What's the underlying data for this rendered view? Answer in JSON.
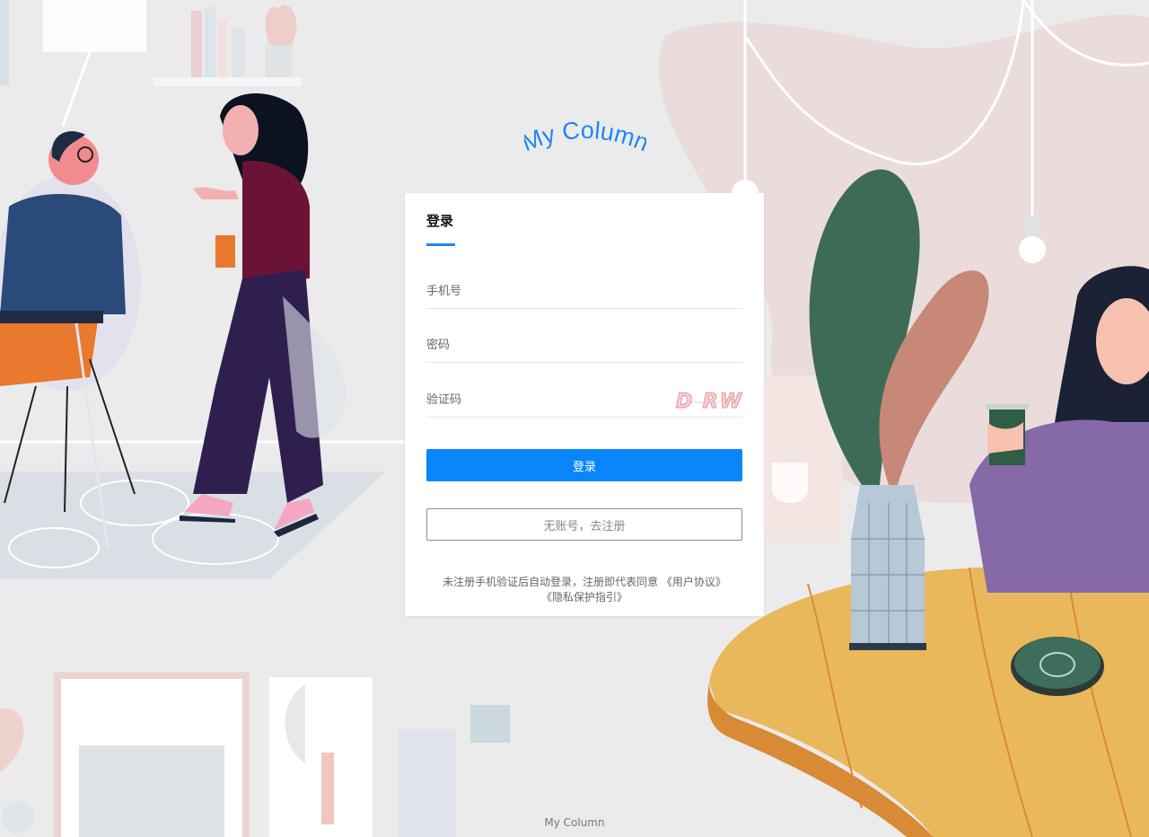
{
  "logo": {
    "text": "My Column"
  },
  "login": {
    "tab_label": "登录",
    "phone": {
      "placeholder": "手机号",
      "value": ""
    },
    "password": {
      "placeholder": "密码",
      "value": ""
    },
    "captcha": {
      "placeholder": "验证码",
      "value": "",
      "image_text": "D RW"
    },
    "submit_label": "登录",
    "register_label": "无账号，去注册",
    "agreement_text": "未注册手机验证后自动登录，注册即代表同意",
    "user_agreement_link": "《用户协议》",
    "privacy_link": "《隐私保护指引》"
  },
  "footer": {
    "text": "My Column"
  },
  "colors": {
    "accent": "#0a86fc",
    "logo": "#1f86f6",
    "background": "#ebebeb"
  }
}
